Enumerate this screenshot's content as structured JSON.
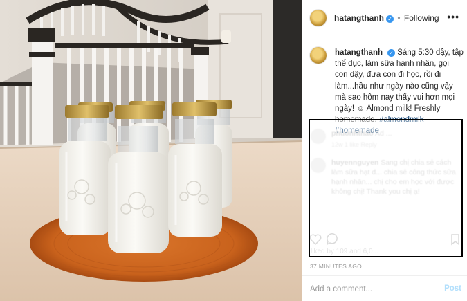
{
  "post": {
    "username": "hatangthanh",
    "follow_status": "Following",
    "more_icon": "•••"
  },
  "caption": {
    "username": "hatangthanh",
    "text": "Sáng 5:30 dậy, tập thể dục, làm sữa hạnh nhân, gọi con dậy, đưa con đi học, rồi đi làm...hầu như ngày nào cũng vậy mà sao hôm nay thấy vui hơn mọi ngày! ☺ Almond milk! Freshly homemade.",
    "hashtags": [
      "#almondmilk",
      "#homemade"
    ]
  },
  "comments": [
    {
      "username": "phuonhthao",
      "text": "Ad ... ",
      "meta": "12w  1 like  Reply"
    },
    {
      "username": "huyennguyen",
      "text": "Sang chị chia sẻ cách làm sữa hạt đ... chia sẻ công thức sữa hạnh nhân... chị cho em học với được không chị! Thank you chị ạ!",
      "meta": ""
    }
  ],
  "likes_text": "liked by 109 and 6,0...",
  "timestamp": "37 MINUTES AGO",
  "add_comment": {
    "placeholder": "Add a comment...",
    "post_label": "Post"
  },
  "colors": {
    "link": "#003569",
    "verified": "#3897f0",
    "post_button": "#b2dffc",
    "redaction_border": "#000000"
  }
}
